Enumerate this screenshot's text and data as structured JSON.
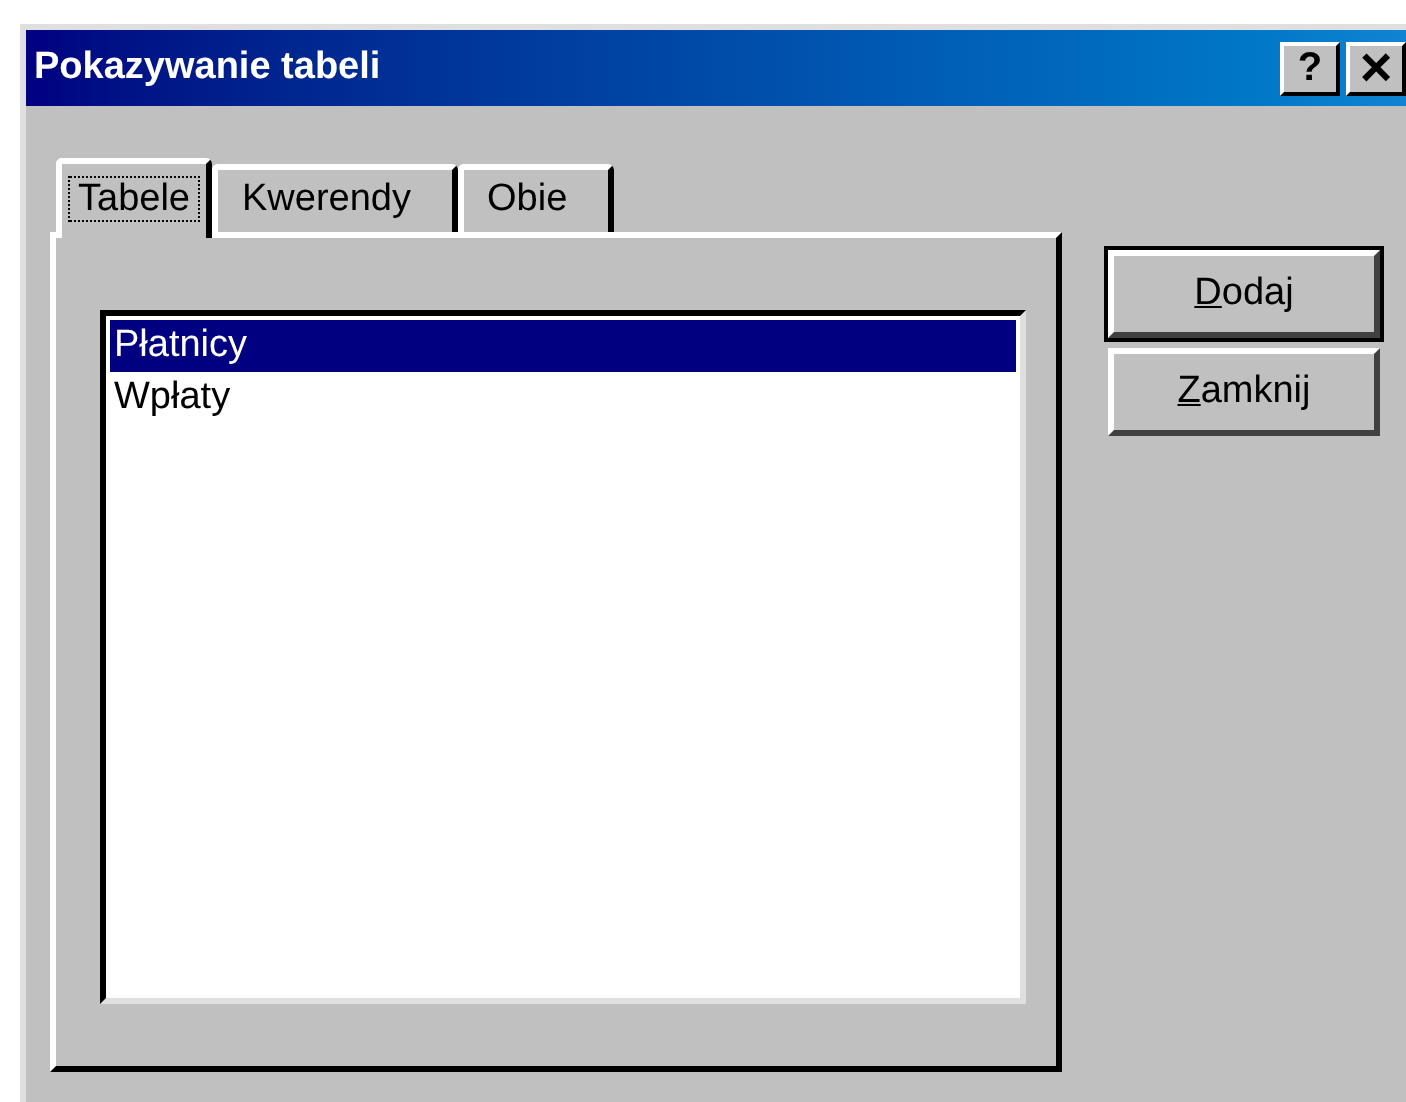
{
  "window": {
    "title": "Pokazywanie tabeli",
    "title_buttons": [
      {
        "kind": "help",
        "label": "?"
      },
      {
        "kind": "close",
        "label": "×"
      }
    ]
  },
  "tabs": [
    {
      "label": "Tabele",
      "selected": true
    },
    {
      "label": "Kwerendy",
      "selected": false
    },
    {
      "label": "Obie",
      "selected": false
    }
  ],
  "list": {
    "items": [
      {
        "label": "Płatnicy",
        "selected": true
      },
      {
        "label": "Wpłaty",
        "selected": false
      }
    ]
  },
  "buttons": [
    {
      "label": "Dodaj",
      "default": true,
      "underline_first": true
    },
    {
      "label": "Zamknij",
      "default": false,
      "underline_first": true
    }
  ]
}
